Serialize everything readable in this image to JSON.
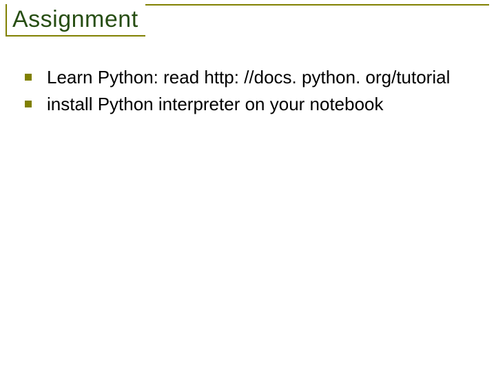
{
  "title": "Assignment",
  "items": [
    "Learn Python: read http: //docs. python. org/tutorial",
    "install Python interpreter on your notebook"
  ]
}
